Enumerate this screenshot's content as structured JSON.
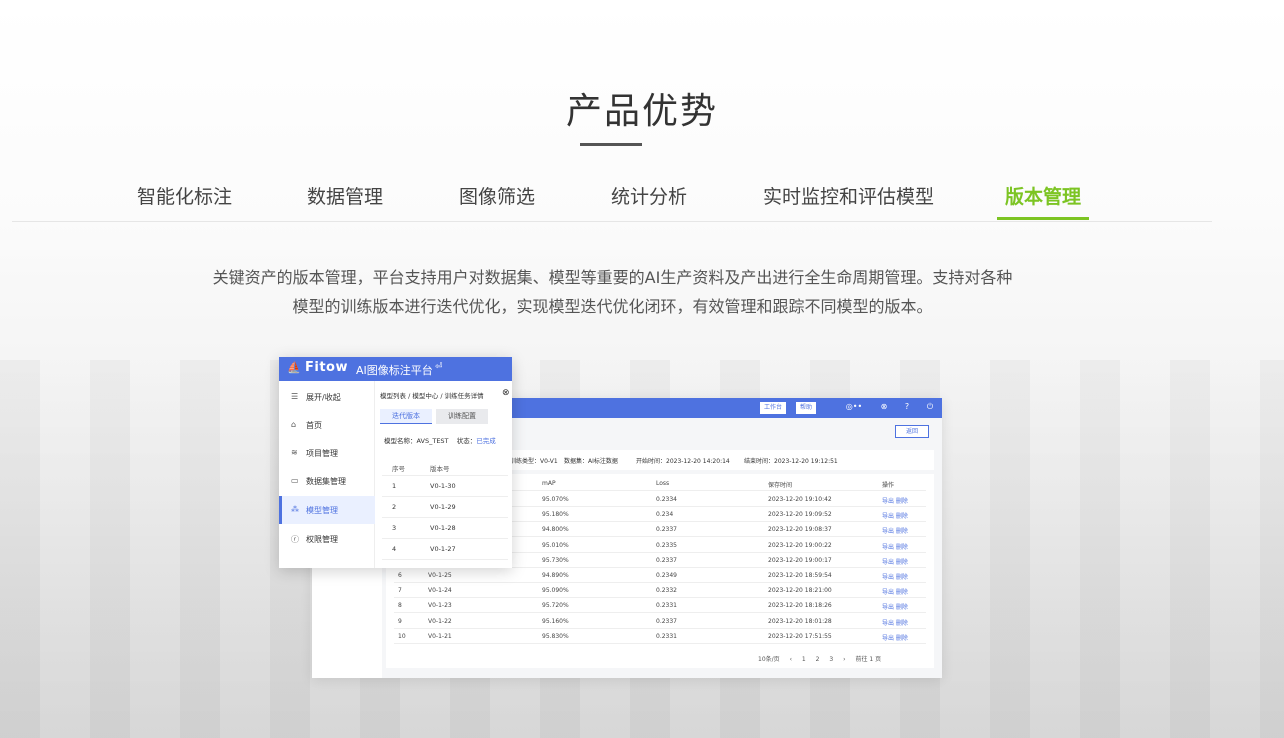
{
  "section": {
    "title": "产品优势",
    "tabs": [
      {
        "label": "智能化标注",
        "active": false
      },
      {
        "label": "数据管理",
        "active": false
      },
      {
        "label": "图像筛选",
        "active": false
      },
      {
        "label": "统计分析",
        "active": false
      },
      {
        "label": "实时监控和评估模型",
        "active": false
      },
      {
        "label": "版本管理",
        "active": true
      }
    ],
    "description_line1": "关键资产的版本管理，平台支持用户对数据集、模型等重要的AI生产资料及产出进行全生命周期管理。支持对各种",
    "description_line2": "模型的训练版本进行迭代优化，实现模型迭代优化闭环，有效管理和跟踪不同模型的版本。",
    "accent_color": "#7cc423"
  },
  "panel": {
    "logo": "Fitow",
    "app_title": "AI图像标注平台",
    "sidebar": [
      {
        "label": "展开/收起",
        "icon": "menu-icon"
      },
      {
        "label": "首页",
        "icon": "home-icon"
      },
      {
        "label": "项目管理",
        "icon": "layers-icon"
      },
      {
        "label": "数据集管理",
        "icon": "folder-icon"
      },
      {
        "label": "模型管理",
        "icon": "model-icon",
        "active": true
      },
      {
        "label": "权限管理",
        "icon": "shield-icon"
      }
    ],
    "breadcrumb": "模型列表 / 模型中心 / 训练任务详情",
    "tabs": [
      "迭代版本",
      "训练配置"
    ],
    "meta_model_label": "模型名称：",
    "meta_model_value": "AVS_TEST",
    "meta_status_label": "状态：",
    "meta_status_value": "已完成",
    "table_headers": [
      "序号",
      "版本号"
    ],
    "rows": [
      {
        "no": "1",
        "version": "V0-1-30"
      },
      {
        "no": "2",
        "version": "V0-1-29"
      },
      {
        "no": "3",
        "version": "V0-1-28"
      },
      {
        "no": "4",
        "version": "V0-1-27"
      }
    ],
    "brand_color": "#4e72e0"
  },
  "screenshot": {
    "top_buttons": [
      "工作台",
      "帮助"
    ],
    "right_button": "返回",
    "info": [
      "训练类型：V0-V1",
      "数据集：AI标注数据",
      "开始时间：2023-12-20 14:20:14",
      "结束时间：2023-12-20 19:12:51"
    ],
    "headers": [
      "",
      "",
      "mAP",
      "Loss",
      "保存时间",
      "操作"
    ],
    "rows": [
      {
        "no": "",
        "version": "",
        "map": "95.070%",
        "loss": "0.2334",
        "time": "2023-12-20 19:10:42",
        "ops": "导出  删除"
      },
      {
        "no": "",
        "version": "",
        "map": "95.180%",
        "loss": "0.234",
        "time": "2023-12-20 19:09:52",
        "ops": "导出  删除"
      },
      {
        "no": "",
        "version": "",
        "map": "94.800%",
        "loss": "0.2337",
        "time": "2023-12-20 19:08:37",
        "ops": "导出  删除"
      },
      {
        "no": "",
        "version": "",
        "map": "95.010%",
        "loss": "0.2335",
        "time": "2023-12-20 19:00:22",
        "ops": "导出  删除"
      },
      {
        "no": "",
        "version": "",
        "map": "95.730%",
        "loss": "0.2337",
        "time": "2023-12-20 19:00:17",
        "ops": "导出  删除"
      },
      {
        "no": "6",
        "version": "V0-1-25",
        "map": "94.890%",
        "loss": "0.2349",
        "time": "2023-12-20 18:59:54",
        "ops": "导出  删除"
      },
      {
        "no": "7",
        "version": "V0-1-24",
        "map": "95.090%",
        "loss": "0.2332",
        "time": "2023-12-20 18:21:00",
        "ops": "导出  删除"
      },
      {
        "no": "8",
        "version": "V0-1-23",
        "map": "95.720%",
        "loss": "0.2331",
        "time": "2023-12-20 18:18:26",
        "ops": "导出  删除"
      },
      {
        "no": "9",
        "version": "V0-1-22",
        "map": "95.160%",
        "loss": "0.2337",
        "time": "2023-12-20 18:01:28",
        "ops": "导出  删除"
      },
      {
        "no": "10",
        "version": "V0-1-21",
        "map": "95.830%",
        "loss": "0.2331",
        "time": "2023-12-20 17:51:55",
        "ops": "导出  删除"
      }
    ],
    "pagination": {
      "page_size": "10条/页",
      "pages": [
        "1",
        "2",
        "3"
      ],
      "goto": "前往  1  页"
    }
  }
}
